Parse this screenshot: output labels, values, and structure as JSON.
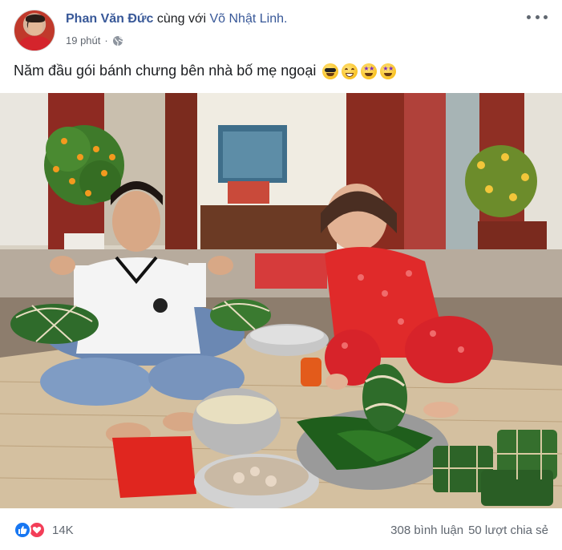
{
  "post": {
    "author": "Phan Văn Đức",
    "with_text": "cùng với",
    "tagged": "Võ Nhật Linh.",
    "time": "19 phút",
    "separator": "·",
    "privacy_icon": "globe-icon",
    "more_icon": "more-horizontal-icon",
    "text": "Năm đầu gói bánh chưng bên nhà bố mẹ ngoại",
    "emojis": [
      "sunglasses-face",
      "grinning-face",
      "star-struck-face",
      "star-struck-face"
    ]
  },
  "footer": {
    "reaction_icons": [
      "like-icon",
      "love-icon"
    ],
    "reaction_count": "14K",
    "comments": "308 bình luận",
    "shares": "50 lượt chia sẻ"
  },
  "colors": {
    "link": "#385898",
    "secondary_text": "#606770",
    "like_blue": "#1877f2",
    "love_red": "#f33e58"
  }
}
